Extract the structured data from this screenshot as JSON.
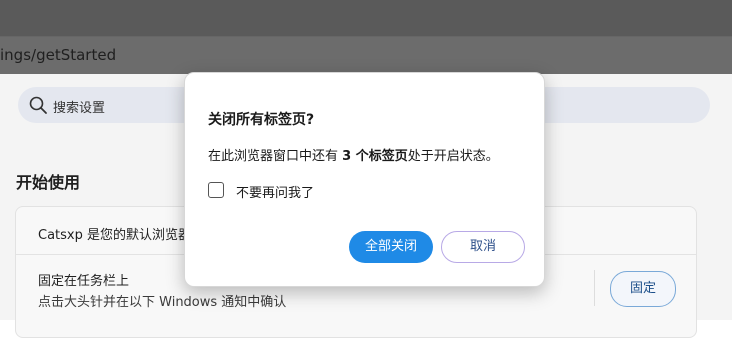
{
  "browser": {
    "url": "ings/getStarted"
  },
  "settings": {
    "search_placeholder": "搜索设置",
    "section_title": "开始使用",
    "default_browser_text": "Catsxp 是您的默认浏览器",
    "pin_title": "固定在任务栏上",
    "pin_desc": "点击大头针并在以下 Windows 通知中确认",
    "pin_button": "固定"
  },
  "dialog": {
    "title": "关闭所有标签页?",
    "message_prefix": "在此浏览器窗口中还有 ",
    "message_bold": "3 个标签页",
    "message_suffix": "处于开启状态。",
    "checkbox_label": "不要再问我了",
    "checkbox_checked": false,
    "close_all_button": "全部关闭",
    "cancel_button": "取消"
  },
  "colors": {
    "primary": "#1f8ae6",
    "overlay": "#5a5a5a"
  },
  "icons": {
    "search": "search-icon"
  }
}
